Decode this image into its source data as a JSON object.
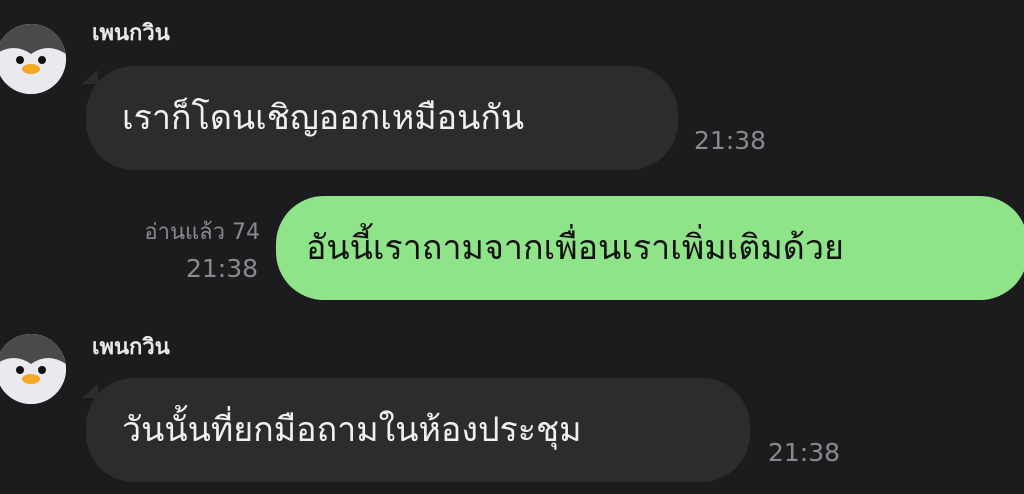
{
  "messages": [
    {
      "direction": "incoming",
      "sender": "เพนกวิน",
      "avatar_icon": "penguin-avatar-icon",
      "text": "เราก็โดนเชิญออกเหมือนกัน",
      "time": "21:38"
    },
    {
      "direction": "outgoing",
      "read_label": "อ่านแล้ว 74",
      "time": "21:38",
      "text": "อันนี้เราถามจากเพื่อนเราเพิ่มเติมด้วย"
    },
    {
      "direction": "incoming",
      "sender": "เพนกวิน",
      "avatar_icon": "penguin-avatar-icon",
      "text": "วันนั้นที่ยกมือถามในห้องประชุม",
      "time": "21:38"
    }
  ],
  "colors": {
    "background": "#1c1c1e",
    "incoming_bubble": "#2c2c2e",
    "outgoing_bubble": "#8fe388",
    "meta_text": "#8a8a8e"
  }
}
